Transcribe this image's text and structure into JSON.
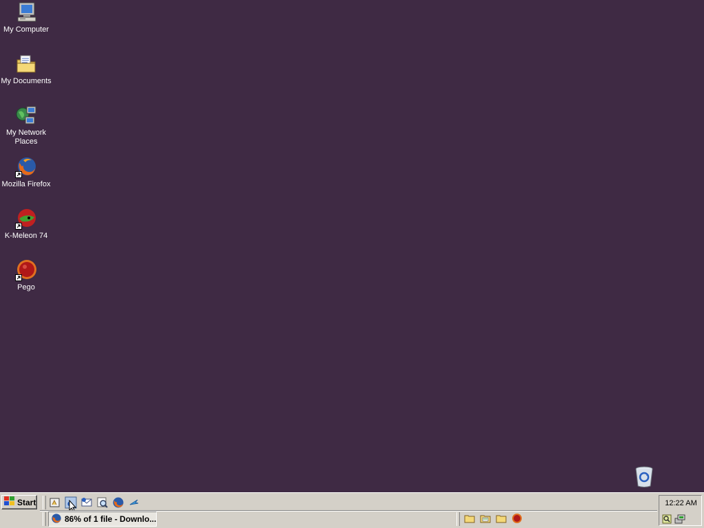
{
  "desktop": {
    "background_color": "#3f2a44",
    "icons": [
      {
        "label": "My Computer",
        "icon": "computer-icon"
      },
      {
        "label": "My Documents",
        "icon": "folder-documents-icon"
      },
      {
        "label": "My Network\nPlaces",
        "icon": "network-icon"
      },
      {
        "label": "Mozilla Firefox",
        "icon": "firefox-icon"
      },
      {
        "label": "K-Meleon 74",
        "icon": "kmeleon-icon"
      },
      {
        "label": "Pego",
        "icon": "pego-icon"
      }
    ],
    "recycle_bin": {
      "icon": "recycle-bin-icon"
    }
  },
  "taskbar": {
    "start_label": "Start",
    "quick_launch": [
      {
        "icon": "show-desktop-icon"
      },
      {
        "icon": "internet-explorer-icon"
      },
      {
        "icon": "outlook-express-icon"
      },
      {
        "icon": "search-icon"
      },
      {
        "icon": "firefox-icon"
      },
      {
        "icon": "arrow-icon"
      }
    ],
    "task": {
      "label": "86% of 1 file - Downlo...",
      "icon": "firefox-icon"
    },
    "tray_folders": [
      {
        "icon": "folder-icon"
      },
      {
        "icon": "folder-documents-icon"
      },
      {
        "icon": "folder-icon"
      },
      {
        "icon": "pego-icon"
      }
    ],
    "clock": "12:22 AM",
    "tray_icons": [
      {
        "icon": "search-tray-icon"
      },
      {
        "icon": "network-tray-icon"
      }
    ]
  }
}
